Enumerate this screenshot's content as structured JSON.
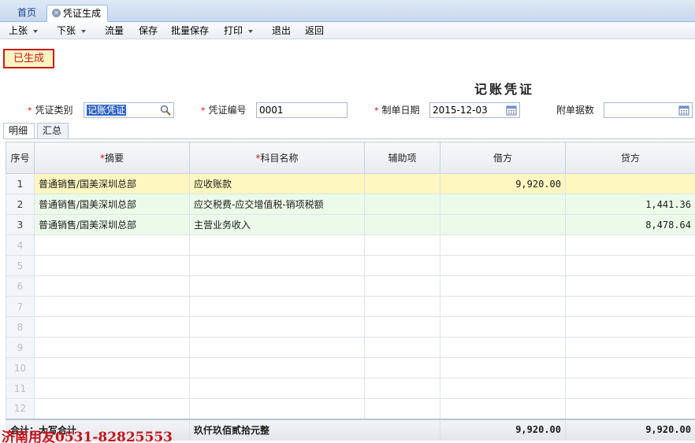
{
  "tabs": [
    {
      "label": "首页"
    },
    {
      "label": "凭证生成"
    }
  ],
  "toolbar": {
    "prev": "上张",
    "next": "下张",
    "flow": "流量",
    "save": "保存",
    "batch_save": "批量保存",
    "print": "打印",
    "exit": "退出",
    "back": "返回"
  },
  "status": "已生成",
  "voucher_title": "记账凭证",
  "form": {
    "type_label": "凭证类别",
    "type_value": "记账凭证",
    "number_label": "凭证编号",
    "number_value": "0001",
    "date_label": "制单日期",
    "date_value": "2015-12-03",
    "attach_label": "附单据数",
    "attach_value": ""
  },
  "subtabs": [
    "明细",
    "汇总"
  ],
  "grid": {
    "headers": {
      "idx": "序号",
      "summary": "摘要",
      "account": "科目名称",
      "aux": "辅助项",
      "debit": "借方",
      "credit": "贷方"
    },
    "rows": [
      {
        "idx": "1",
        "summary": "普通销售/国美深圳总部",
        "account": "应收账款",
        "aux": "",
        "debit": "9,920.00",
        "credit": ""
      },
      {
        "idx": "2",
        "summary": "普通销售/国美深圳总部",
        "account": "应交税费-应交增值税-销项税额",
        "aux": "",
        "debit": "",
        "credit": "1,441.36"
      },
      {
        "idx": "3",
        "summary": "普通销售/国美深圳总部",
        "account": "主营业务收入",
        "aux": "",
        "debit": "",
        "credit": "8,478.64"
      },
      {
        "idx": "4",
        "summary": "",
        "account": "",
        "aux": "",
        "debit": "",
        "credit": ""
      },
      {
        "idx": "5",
        "summary": "",
        "account": "",
        "aux": "",
        "debit": "",
        "credit": ""
      },
      {
        "idx": "6",
        "summary": "",
        "account": "",
        "aux": "",
        "debit": "",
        "credit": ""
      },
      {
        "idx": "7",
        "summary": "",
        "account": "",
        "aux": "",
        "debit": "",
        "credit": ""
      },
      {
        "idx": "8",
        "summary": "",
        "account": "",
        "aux": "",
        "debit": "",
        "credit": ""
      },
      {
        "idx": "9",
        "summary": "",
        "account": "",
        "aux": "",
        "debit": "",
        "credit": ""
      },
      {
        "idx": "10",
        "summary": "",
        "account": "",
        "aux": "",
        "debit": "",
        "credit": ""
      },
      {
        "idx": "11",
        "summary": "",
        "account": "",
        "aux": "",
        "debit": "",
        "credit": ""
      },
      {
        "idx": "12",
        "summary": "",
        "account": "",
        "aux": "",
        "debit": "",
        "credit": ""
      }
    ],
    "total": {
      "label": "合计：大写合计",
      "amount_words": "玖仟玖佰贰拾元整",
      "debit": "9,920.00",
      "credit": "9,920.00"
    }
  },
  "watermark": "济南用友0531-82825553",
  "colors": {
    "row_highlight": "#fff6c0",
    "row_normal": "#ecfbe9",
    "status_border": "#c81a1a"
  },
  "icons": {
    "type_lookup": "search-icon",
    "date_picker": "calendar-icon",
    "attach_picker": "calendar-icon"
  }
}
